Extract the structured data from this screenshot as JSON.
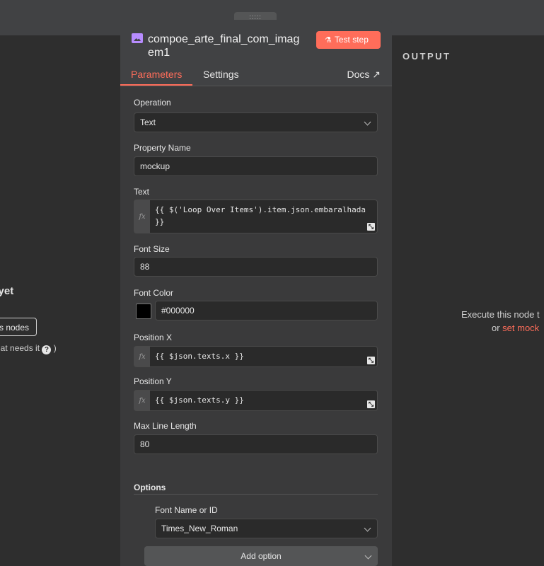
{
  "node": {
    "title": "compoe_arte_final_com_imagem1",
    "test_button": "Test step",
    "drag_handle": ":::::"
  },
  "tabs": {
    "parameters": "Parameters",
    "settings": "Settings",
    "docs": "Docs"
  },
  "fields": {
    "operation": {
      "label": "Operation",
      "value": "Text"
    },
    "property_name": {
      "label": "Property Name",
      "value": "mockup"
    },
    "text": {
      "label": "Text",
      "value": "{{ $('Loop Over Items').item.json.embaralhada }}"
    },
    "font_size": {
      "label": "Font Size",
      "value": "88"
    },
    "font_color": {
      "label": "Font Color",
      "value": "#000000",
      "swatch": "#000000"
    },
    "position_x": {
      "label": "Position X",
      "value": "{{ $json.texts.x }}"
    },
    "position_y": {
      "label": "Position Y",
      "value": "{{ $json.texts.y }}"
    },
    "max_line_length": {
      "label": "Max Line Length",
      "value": "80"
    }
  },
  "options": {
    "label": "Options",
    "font_name": {
      "label": "Font Name or ID",
      "value": "Times_New_Roman"
    },
    "add_option": "Add option"
  },
  "fx_label": "fx",
  "output": {
    "label": "OUTPUT",
    "execute_text": "Execute this node t",
    "mock_prefix": "or ",
    "mock_link": "set mock"
  },
  "input_side": {
    "title": "ta yet",
    "button": "s nodes",
    "hint": "hat needs it"
  },
  "colors": {
    "accent": "#ff6d5a",
    "panel": "#414244",
    "background": "#2e2e2e"
  }
}
